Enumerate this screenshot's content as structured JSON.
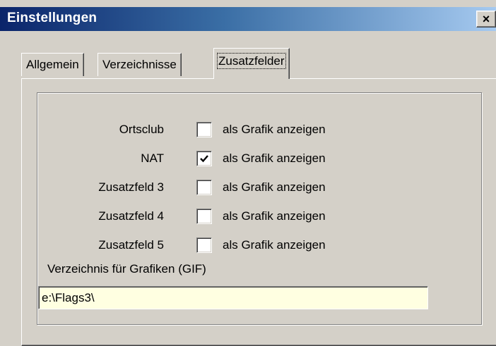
{
  "window": {
    "title": "Einstellungen",
    "close_glyph": "×"
  },
  "tabs": [
    {
      "label": "Allgemein",
      "active": false
    },
    {
      "label": "Verzeichnisse",
      "active": false
    },
    {
      "label": "Zusatzfelder",
      "active": true
    }
  ],
  "fields": [
    {
      "label": "Ortsclub",
      "checkbox_label": "als Grafik anzeigen",
      "checked": false
    },
    {
      "label": "NAT",
      "checkbox_label": "als Grafik anzeigen",
      "checked": true
    },
    {
      "label": "Zusatzfeld 3",
      "checkbox_label": "als Grafik anzeigen",
      "checked": false
    },
    {
      "label": "Zusatzfeld 4",
      "checkbox_label": "als Grafik anzeigen",
      "checked": false
    },
    {
      "label": "Zusatzfeld 5",
      "checkbox_label": "als Grafik anzeigen",
      "checked": false
    }
  ],
  "directory": {
    "label": "Verzeichnis für Grafiken (GIF)",
    "value": "e:\\Flags3\\"
  },
  "colors": {
    "title_start": "#0a246a",
    "title_end": "#a6caf0",
    "face": "#d4d0c8",
    "input_bg": "#ffffe1"
  }
}
